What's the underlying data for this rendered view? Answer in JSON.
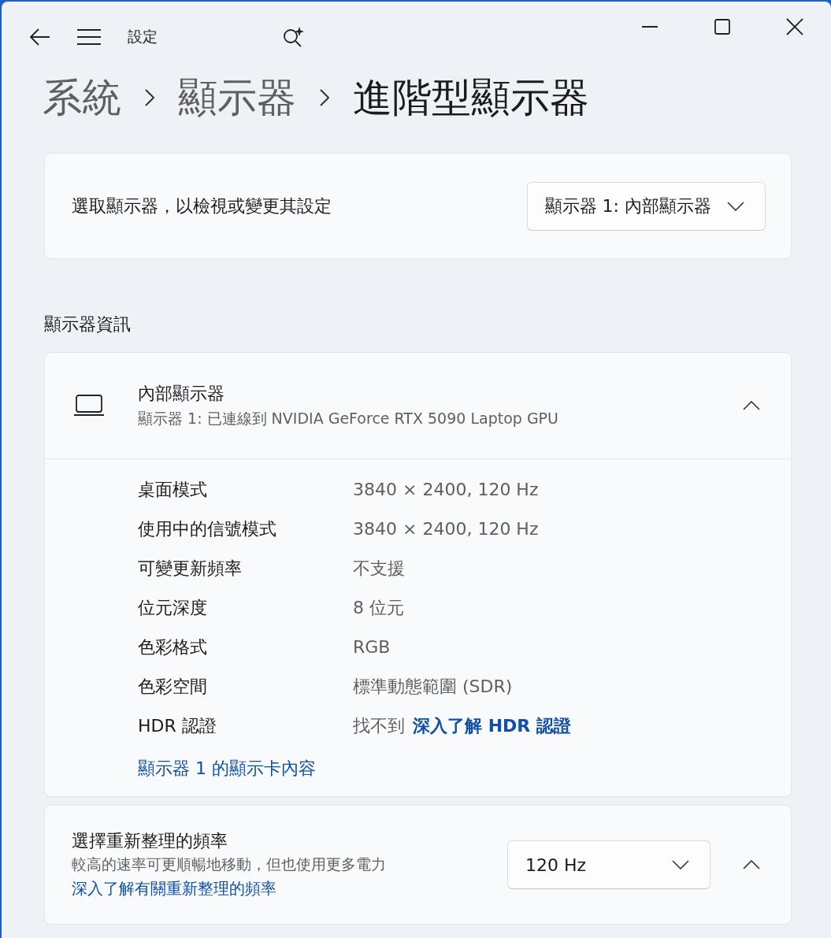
{
  "window": {
    "title": "設定"
  },
  "breadcrumb": [
    "系統",
    "顯示器",
    "進階型顯示器"
  ],
  "display_select": {
    "label": "選取顯示器，以檢視或變更其設定",
    "value": "顯示器 1: 內部顯示器"
  },
  "section_title": "顯示器資訊",
  "display_info": {
    "title": "內部顯示器",
    "subtitle": "顯示器 1: 已連線到 NVIDIA GeForce RTX 5090 Laptop GPU",
    "expanded": true,
    "rows": [
      {
        "label": "桌面模式",
        "value": "3840 × 2400, 120 Hz"
      },
      {
        "label": "使用中的信號模式",
        "value": "3840 × 2400, 120 Hz"
      },
      {
        "label": "可變更新頻率",
        "value": "不支援"
      },
      {
        "label": "位元深度",
        "value": "8 位元"
      },
      {
        "label": "色彩格式",
        "value": "RGB"
      },
      {
        "label": "色彩空間",
        "value": "標準動態範圍 (SDR)"
      },
      {
        "label": "HDR 認證",
        "value": "找不到",
        "link": "深入了解 HDR 認證"
      }
    ],
    "link": "顯示器 1 的顯示卡內容"
  },
  "refresh_rate": {
    "title": "選擇重新整理的頻率",
    "description": "較高的速率可更順暢地移動，但也使用更多電力",
    "link": "深入了解有關重新整理的頻率",
    "value": "120 Hz",
    "expanded": true
  }
}
